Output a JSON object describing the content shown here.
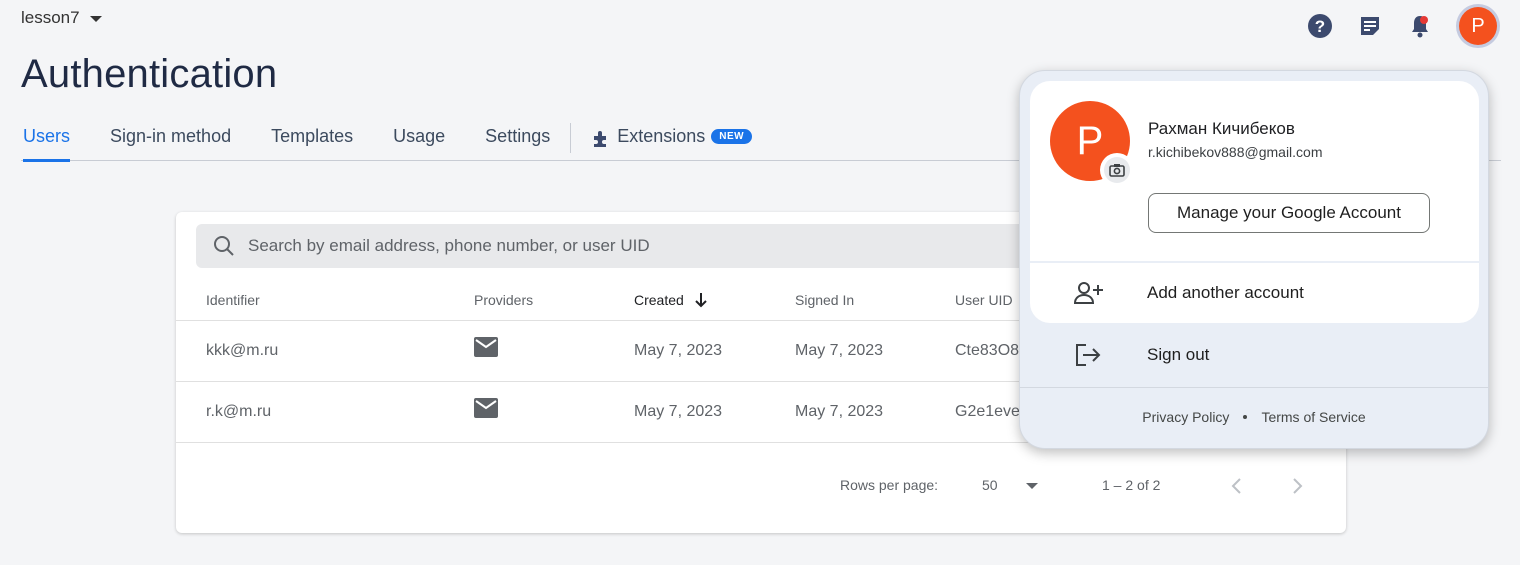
{
  "header": {
    "project_name": "lesson7",
    "page_title": "Authentication",
    "avatar_letter": "P"
  },
  "tabs": [
    {
      "label": "Users",
      "active": true
    },
    {
      "label": "Sign-in method"
    },
    {
      "label": "Templates"
    },
    {
      "label": "Usage"
    },
    {
      "label": "Settings"
    },
    {
      "label": "Extensions",
      "badge": "NEW"
    }
  ],
  "users_table": {
    "search_placeholder": "Search by email address, phone number, or user UID",
    "columns": [
      "Identifier",
      "Providers",
      "Created",
      "Signed In",
      "User UID"
    ],
    "sorted_column": "Created",
    "rows": [
      {
        "identifier": "kkk@m.ru",
        "provider_icon": "mail-icon",
        "created": "May 7, 2023",
        "signed_in": "May 7, 2023",
        "uid": "Cte83O8"
      },
      {
        "identifier": "r.k@m.ru",
        "provider_icon": "mail-icon",
        "created": "May 7, 2023",
        "signed_in": "May 7, 2023",
        "uid": "G2e1eve"
      }
    ],
    "pagination": {
      "rows_per_page_label": "Rows per page:",
      "rows_per_page": "50",
      "range": "1 – 2 of 2"
    }
  },
  "account_menu": {
    "avatar_letter": "P",
    "name": "Рахман Кичибеков",
    "email": "r.kichibekov888@gmail.com",
    "manage_label": "Manage your Google Account",
    "add_account_label": "Add another account",
    "sign_out_label": "Sign out",
    "privacy_label": "Privacy Policy",
    "terms_label": "Terms of Service"
  },
  "colors": {
    "accent": "#1a73e8",
    "avatar": "#f4511e",
    "title": "#1f2a44"
  }
}
